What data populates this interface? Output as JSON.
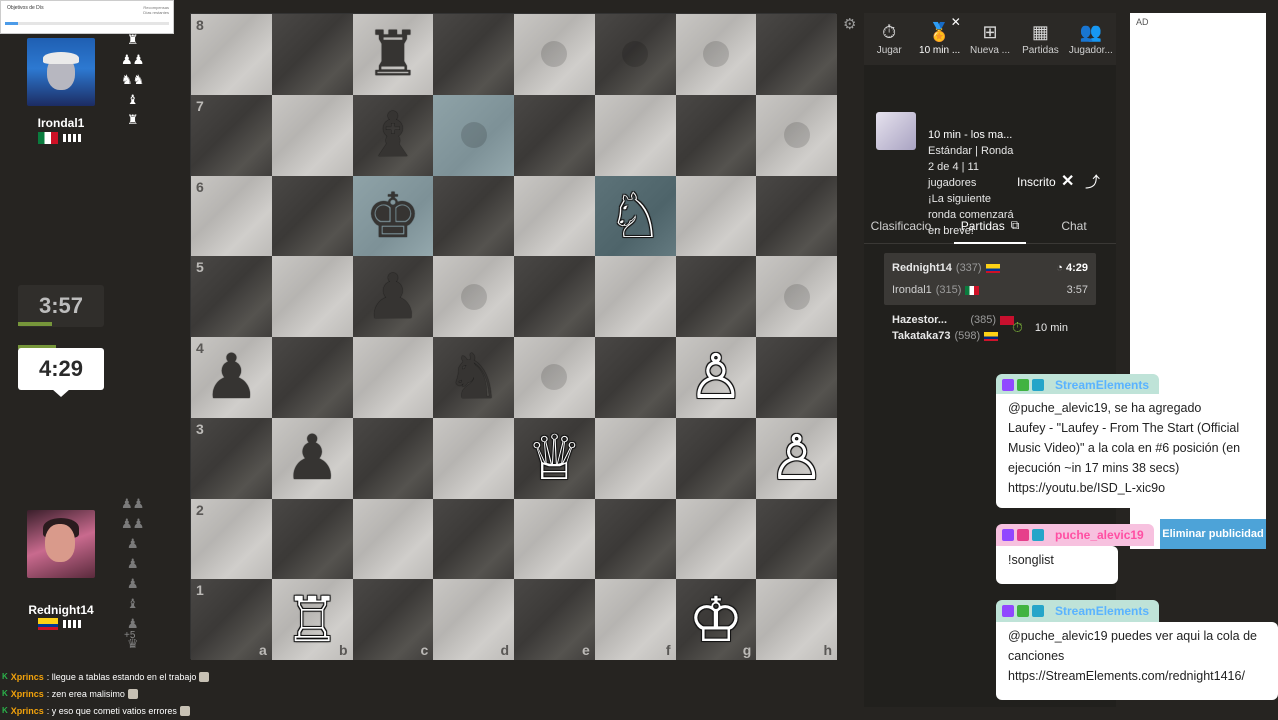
{
  "objectives": {
    "title": "Objetivos de Dís",
    "side1": "Recompensas",
    "side2": "Días restantes",
    "progress": 0.08
  },
  "top_player": {
    "name": "Irondal1",
    "clock": "3:57",
    "captured": [
      "♜",
      "♟♟",
      "♞♞",
      "♝",
      "♜"
    ]
  },
  "bottom_player": {
    "name": "Rednight14",
    "clock": "4:29",
    "captured": [
      "♟♟",
      "♟♟",
      "♟",
      "♟",
      "♟",
      "♝",
      "♟",
      "♛"
    ],
    "plus": "+5"
  },
  "board": {
    "ranks": [
      "8",
      "7",
      "6",
      "5",
      "4",
      "3",
      "2",
      "1"
    ],
    "files": [
      "a",
      "b",
      "c",
      "d",
      "e",
      "f",
      "g",
      "h"
    ],
    "squares": [
      [
        "",
        "",
        "♜",
        "",
        "",
        "",
        "",
        ""
      ],
      [
        "",
        "",
        "♝",
        "",
        "",
        "",
        "",
        ""
      ],
      [
        "",
        "",
        "♚",
        "",
        "",
        "♘",
        "",
        ""
      ],
      [
        "",
        "",
        "♟",
        "",
        "",
        "",
        "",
        ""
      ],
      [
        "♟",
        "",
        "",
        "♞",
        "",
        "",
        "♙",
        ""
      ],
      [
        "",
        "♟",
        "",
        "",
        "♕",
        "",
        "",
        "♙"
      ],
      [
        "",
        "",
        "",
        "",
        "",
        "",
        "",
        ""
      ],
      [
        "",
        "♖",
        "",
        "",
        "",
        "",
        "♔",
        ""
      ]
    ],
    "colors": [
      [
        "",
        "",
        "b",
        "",
        "",
        "",
        "",
        ""
      ],
      [
        "",
        "",
        "b",
        "",
        "",
        "",
        "",
        ""
      ],
      [
        "",
        "",
        "b",
        "",
        "",
        "w",
        "",
        ""
      ],
      [
        "",
        "",
        "b",
        "",
        "",
        "",
        "",
        ""
      ],
      [
        "b",
        "",
        "",
        "b",
        "",
        "",
        "w",
        ""
      ],
      [
        "",
        "b",
        "",
        "",
        "w",
        "",
        "",
        "w"
      ],
      [
        "",
        "",
        "",
        "",
        "",
        "",
        "",
        ""
      ],
      [
        "",
        "w",
        "",
        "",
        "",
        "",
        "w",
        ""
      ]
    ],
    "highlights": [
      "d7",
      "c6",
      "f6"
    ],
    "hints": [
      "e8",
      "f8",
      "g8",
      "h7",
      "d7",
      "d5",
      "e4",
      "h5",
      "h7"
    ]
  },
  "nav": [
    {
      "icon": "⏱",
      "label": "Jugar"
    },
    {
      "icon": "🏅",
      "label": "10 min ..."
    },
    {
      "icon": "⊞",
      "label": "Nueva ..."
    },
    {
      "icon": "▦",
      "label": "Partidas"
    },
    {
      "icon": "👥",
      "label": "Jugador..."
    }
  ],
  "tournament": {
    "title": "10 min - los ma...",
    "lines": [
      "Estándar | Ronda",
      "2 de 4 | 11",
      "jugadores",
      "¡La siguiente",
      "ronda comenzará",
      "en breve!"
    ],
    "status": "Inscrito"
  },
  "subtabs": [
    "Clasificacio...",
    "Partidas",
    "Chat"
  ],
  "games": [
    {
      "p1": "Rednight14",
      "r1": "(337)",
      "t1": "4:29",
      "p2": "Irondal1",
      "r2": "(315)",
      "t2": "3:57"
    },
    {
      "p1": "Hazestor...",
      "r1": "(385)",
      "p2": "Takataka73",
      "r2": "(598)",
      "tc": "10 min"
    }
  ],
  "ad": {
    "label": "AD",
    "remove": "Eliminar publicidad"
  },
  "stream_chat": [
    {
      "user": "StreamElements",
      "color": "#5ab3ff",
      "text": "@puche_alevic19, se ha agregado Laufey - \"Laufey - From The Start (Official Music Video)\" a la cola en #6 posición (en ejecución ~in 17 mins 38 secs) https://youtu.be/ISD_L-xic9o"
    },
    {
      "user": "puche_alevic19",
      "color": "#ff4fa3",
      "text": "!songlist"
    },
    {
      "user": "StreamElements",
      "color": "#5ab3ff",
      "text": "@puche_alevic19 puedes ver aqui la cola de canciones https://StreamElements.com/rednight1416/"
    }
  ],
  "bottom_chat": [
    {
      "user": "Xprincs",
      "text": ": llegue a tablas estando en el trabajo"
    },
    {
      "user": "Xprincs",
      "text": ": zen erea malisimo"
    },
    {
      "user": "Xprincs",
      "text": ": y eso que cometi vatios errores"
    }
  ]
}
